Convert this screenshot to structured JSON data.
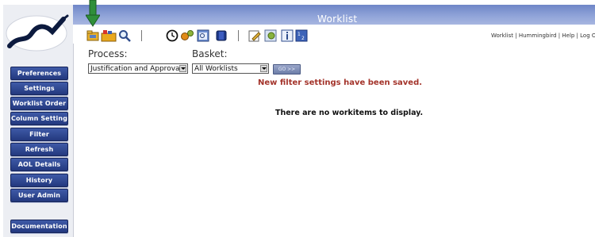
{
  "header": {
    "title": "Worklist"
  },
  "user_links": "Worklist | Hummingbird | Help | Log Out",
  "sidebar": {
    "items": [
      {
        "label": "Preferences"
      },
      {
        "label": "Settings"
      },
      {
        "label": "Worklist Order"
      },
      {
        "label": "Column Settings"
      },
      {
        "label": "Filter"
      },
      {
        "label": "Refresh"
      },
      {
        "label": "AOL Details"
      },
      {
        "label": "History"
      },
      {
        "label": "User Admin"
      },
      {
        "label": "Documentation"
      }
    ]
  },
  "filters": {
    "process_label": "Process:",
    "process_value": "Justification and Approval",
    "basket_label": "Basket:",
    "basket_value": "All Worklists",
    "go_label": "GO >>"
  },
  "messages": {
    "saved": "New filter settings have been saved.",
    "empty": "There are no workitems to display."
  },
  "colors": {
    "header_blue": "#7b90cc",
    "sidebar_button": "#2b418a",
    "saved_message": "#a3332a",
    "arrow_green": "#2f8f3a"
  },
  "icons": [
    "open-folder-icon",
    "folder-with-icons-icon",
    "magnifier-icon",
    "clock-icon",
    "gears-icon",
    "calendar-view-icon",
    "book-icon",
    "edit-pencil-icon",
    "properties-icon",
    "info-icon",
    "numbered-list-icon"
  ]
}
